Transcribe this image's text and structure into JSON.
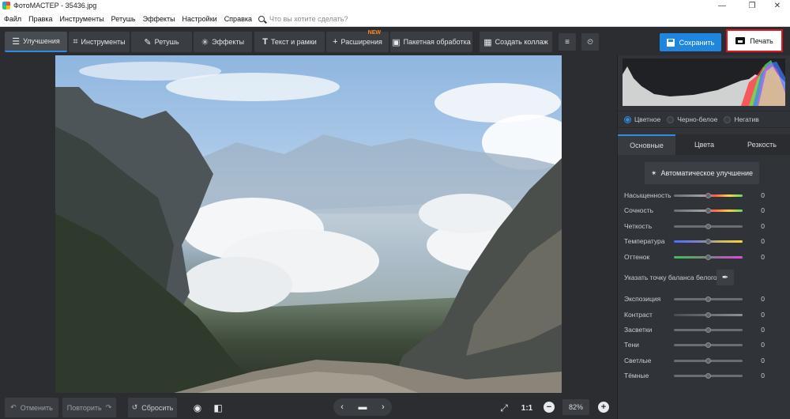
{
  "window": {
    "title": "ФотоМАСТЕР - 35436.jpg",
    "minimize": "—",
    "maximize": "❐",
    "close": "✕"
  },
  "menu": {
    "items": [
      "Файл",
      "Правка",
      "Инструменты",
      "Ретушь",
      "Эффекты",
      "Настройки",
      "Справка"
    ],
    "search_placeholder": "Что вы хотите сделать?"
  },
  "toolbar": {
    "tabs": [
      {
        "label": "Улучшения",
        "icon": "sliders-icon",
        "active": true
      },
      {
        "label": "Инструменты",
        "icon": "crop-icon"
      },
      {
        "label": "Ретушь",
        "icon": "brush-icon"
      },
      {
        "label": "Эффекты",
        "icon": "sparkle-icon"
      },
      {
        "label": "Текст и рамки",
        "icon": "text-icon"
      },
      {
        "label": "Расширения",
        "icon": "plus-icon",
        "badge": "NEW"
      },
      {
        "label": "Пакетная обработка",
        "icon": "image-icon"
      },
      {
        "label": "Создать коллаж",
        "icon": "grid-icon"
      }
    ],
    "save_label": "Сохранить",
    "print_label": "Печать"
  },
  "bottom": {
    "undo_label": "Отменить",
    "redo_label": "Повторить",
    "reset_label": "Сбросить",
    "ratio_label": "1:1",
    "zoom_value": "82%"
  },
  "panel": {
    "modes": [
      {
        "label": "Цветное",
        "selected": true
      },
      {
        "label": "Черно-белое",
        "selected": false
      },
      {
        "label": "Негатив",
        "selected": false
      }
    ],
    "tabs": [
      {
        "label": "Основные",
        "active": true
      },
      {
        "label": "Цвета",
        "active": false
      },
      {
        "label": "Резкость",
        "active": false
      }
    ],
    "auto_label": "Автоматическое улучшение",
    "white_balance_label": "Указать точку баланса белого",
    "sliders_top": [
      {
        "label": "Насыщенность",
        "value": "0"
      },
      {
        "label": "Сочность",
        "value": "0"
      },
      {
        "label": "Четкость",
        "value": "0"
      },
      {
        "label": "Температура",
        "value": "0"
      },
      {
        "label": "Оттенок",
        "value": "0"
      }
    ],
    "sliders_bottom": [
      {
        "label": "Экспозиция",
        "value": "0"
      },
      {
        "label": "Контраст",
        "value": "0"
      },
      {
        "label": "Засветки",
        "value": "0"
      },
      {
        "label": "Тени",
        "value": "0"
      },
      {
        "label": "Светлые",
        "value": "0"
      },
      {
        "label": "Тёмные",
        "value": "0"
      }
    ]
  },
  "colors": {
    "accent": "#2f8be6",
    "save_button": "#1f86e0",
    "print_highlight": "#e0181d",
    "new_badge": "#ff8a1c"
  }
}
